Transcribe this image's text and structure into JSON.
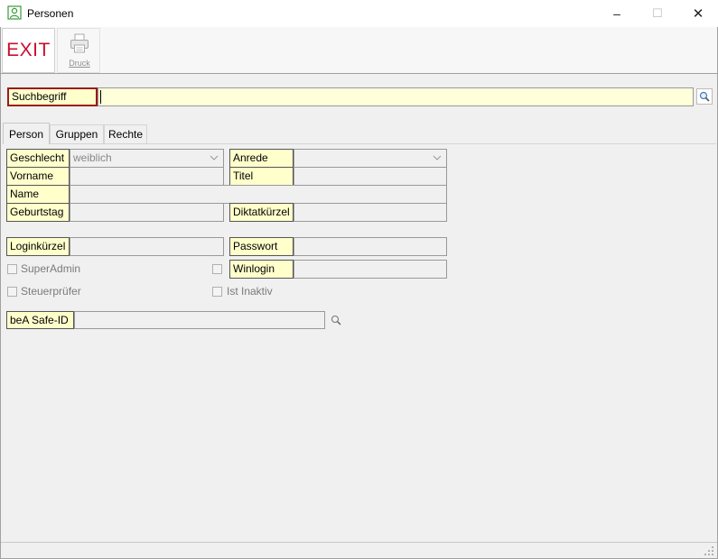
{
  "window": {
    "title": "Personen",
    "minimize_glyph": "–",
    "maximize_glyph": "☐",
    "close_glyph": "✕"
  },
  "toolbar": {
    "exit_label": "EXIT",
    "druck_label": "Druck"
  },
  "search": {
    "label": "Suchbegriff",
    "value": ""
  },
  "tabs": [
    {
      "label": "Person",
      "active": true
    },
    {
      "label": "Gruppen",
      "active": false
    },
    {
      "label": "Rechte",
      "active": false
    }
  ],
  "person": {
    "geschlecht_label": "Geschlecht",
    "geschlecht_value": "weiblich",
    "anrede_label": "Anrede",
    "anrede_value": "",
    "vorname_label": "Vorname",
    "vorname_value": "",
    "titel_label": "Titel",
    "titel_value": "",
    "name_label": "Name",
    "name_value": "",
    "geburtstag_label": "Geburtstag",
    "geburtstag_value": "",
    "diktatkuerzel_label": "Diktatkürzel",
    "diktatkuerzel_value": "",
    "loginkuerzel_label": "Loginkürzel",
    "loginkuerzel_value": "",
    "passwort_label": "Passwort",
    "passwort_value": "",
    "superadmin_label": "SuperAdmin",
    "winlogin_label": "Winlogin",
    "winlogin_value": "",
    "steuerpruefer_label": "Steuerprüfer",
    "ist_inaktiv_label": "Ist Inaktiv",
    "bea_label": "beA Safe-ID",
    "bea_value": ""
  },
  "colors": {
    "label_bg": "#ffffcc",
    "search_bg": "#ffffd9",
    "exit_red": "#c8102e",
    "focus_border": "#9b1b1b",
    "app_icon": "#3a9a3a"
  },
  "icons": {
    "app": "person-icon",
    "printer": "printer-icon",
    "search": "magnifier-icon",
    "dropdown": "chevron-down-icon"
  }
}
